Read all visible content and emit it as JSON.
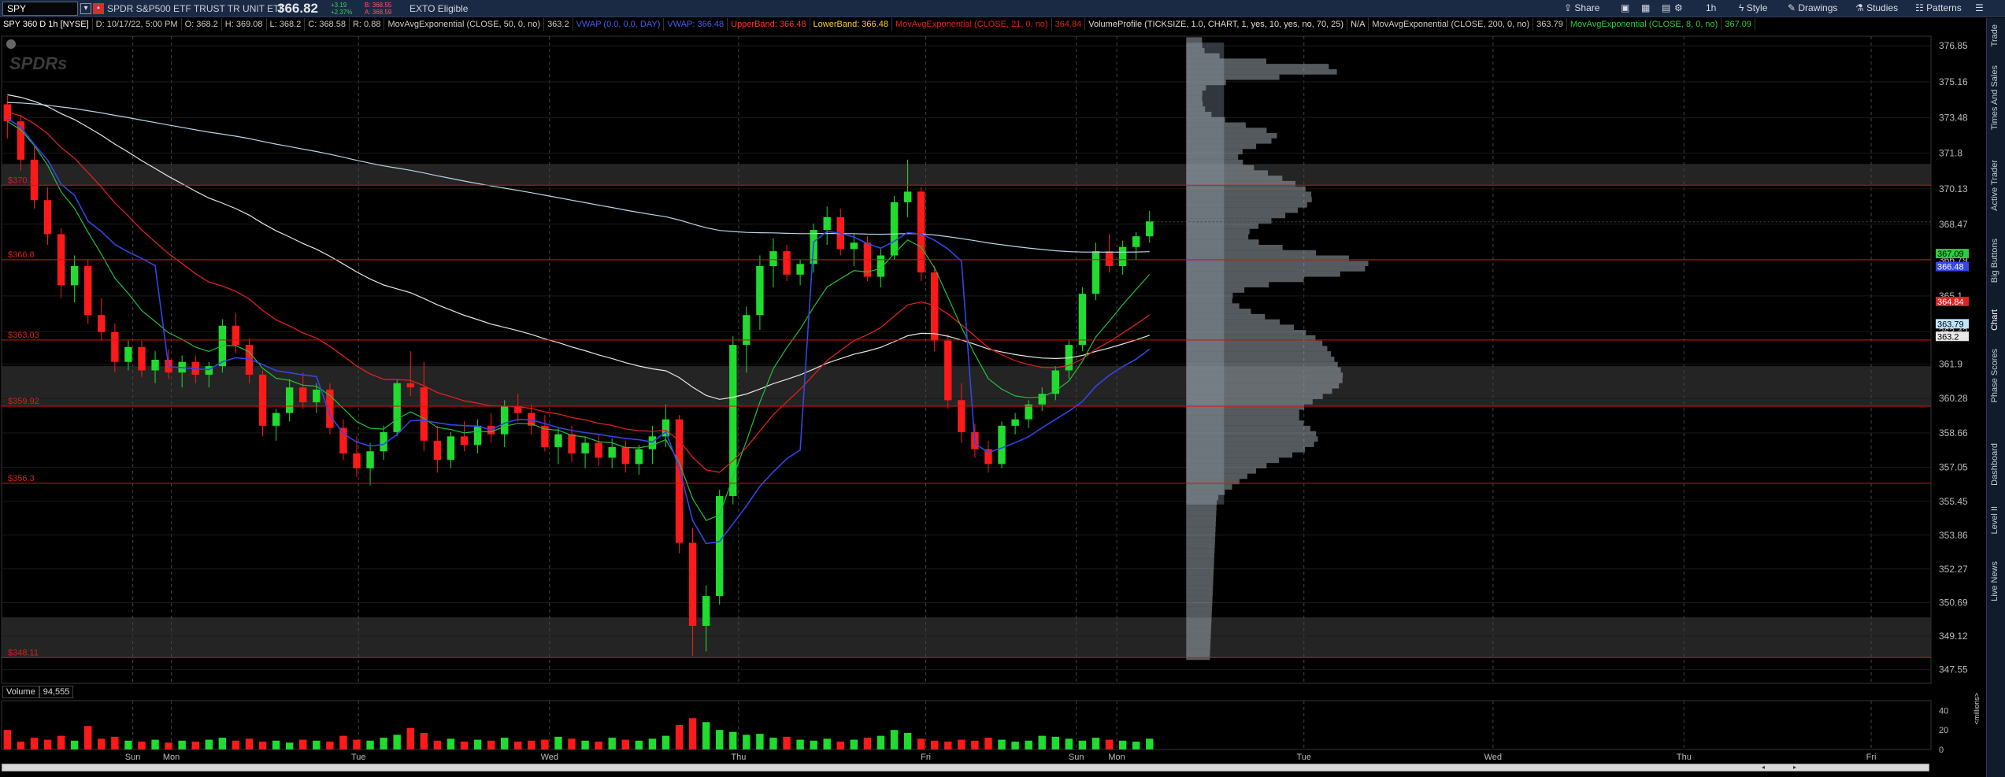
{
  "toolbar": {
    "symbol": "SPY",
    "instrument_name": "SPDR S&P500 ETF TRUST TR UNIT ETF",
    "last_price": "366.82",
    "change_abs": "+3.19",
    "change_pct": "+2.37%",
    "bid": "B: 368.55",
    "ask": "A: 368.59",
    "exto": "EXTO Eligible",
    "share": "Share",
    "timeframe": "1h",
    "style": "Style",
    "drawings": "Drawings",
    "studies": "Studies",
    "patterns": "Patterns"
  },
  "studies": [
    {
      "text": "SPY 360 D 1h [NYSE]",
      "color": "#ffffff"
    },
    {
      "text": "D: 10/17/22, 5:00 PM",
      "color": "#cccccc"
    },
    {
      "text": "O: 368.2",
      "color": "#cccccc"
    },
    {
      "text": "H: 369.08",
      "color": "#cccccc"
    },
    {
      "text": "L: 368.2",
      "color": "#cccccc"
    },
    {
      "text": "C: 368.58",
      "color": "#cccccc"
    },
    {
      "text": "R: 0.88",
      "color": "#cccccc"
    },
    {
      "text": "MovAvgExponential (CLOSE, 50, 0, no)",
      "color": "#cccccc"
    },
    {
      "text": "363.2",
      "color": "#cccccc"
    },
    {
      "text": "VWAP (0.0, 0.0, DAY)",
      "color": "#4a5cf0"
    },
    {
      "text": "VWAP: 366.48",
      "color": "#4a5cf0"
    },
    {
      "text": "UpperBand: 366.48",
      "color": "#ff3333"
    },
    {
      "text": "LowerBand: 366.48",
      "color": "#ffcc33"
    },
    {
      "text": "MovAvgExponential (CLOSE, 21, 0, no)",
      "color": "#e02020"
    },
    {
      "text": "364.84",
      "color": "#e02020"
    },
    {
      "text": "VolumeProfile (TICKSIZE, 1.0, CHART, 1, yes, 10, yes, no, 70, 25)",
      "color": "#dddddd"
    },
    {
      "text": "N/A",
      "color": "#dddddd"
    },
    {
      "text": "MovAvgExponential (CLOSE, 200, 0, no)",
      "color": "#cccccc"
    },
    {
      "text": "363.79",
      "color": "#cccccc"
    },
    {
      "text": "MovAvgExponential (CLOSE, 8, 0, no)",
      "color": "#2ecc40"
    },
    {
      "text": "367.09",
      "color": "#2ecc40"
    }
  ],
  "side_tabs": [
    "Trade",
    "Times And Sales",
    "Active Trader",
    "Big Buttons",
    "Chart",
    "Phase Scores",
    "Dashboard",
    "Level II",
    "Live News"
  ],
  "volume": {
    "label": "Volume",
    "value": "94,555"
  },
  "volume_axis_unit": "<millions>",
  "chart_data": {
    "type": "candlestick",
    "symbol": "SPY",
    "aggregation": "1h",
    "y_ticks": [
      376.85,
      375.16,
      373.48,
      371.8,
      370.13,
      368.47,
      366.79,
      365.1,
      363.42,
      361.9,
      360.28,
      358.66,
      357.05,
      355.45,
      353.86,
      352.27,
      350.69,
      349.12,
      347.55
    ],
    "y_range": [
      346.9,
      377.3
    ],
    "x_labels": [
      {
        "label": "Sun",
        "pos": 0.068
      },
      {
        "label": "Mon",
        "pos": 0.088
      },
      {
        "label": "Tue",
        "pos": 0.185
      },
      {
        "label": "Wed",
        "pos": 0.284
      },
      {
        "label": "Thu",
        "pos": 0.382
      },
      {
        "label": "Fri",
        "pos": 0.479
      },
      {
        "label": "Sun",
        "pos": 0.557
      },
      {
        "label": "Mon",
        "pos": 0.578
      },
      {
        "label": "Tue",
        "pos": 0.675
      },
      {
        "label": "Wed",
        "pos": 0.773
      },
      {
        "label": "Thu",
        "pos": 0.872
      },
      {
        "label": "Fri",
        "pos": 0.969
      }
    ],
    "price_lines": [
      {
        "label": "$370.3",
        "value": 370.3
      },
      {
        "label": "$366.8",
        "value": 366.8
      },
      {
        "label": "$363.03",
        "value": 363.03
      },
      {
        "label": "$359.92",
        "value": 359.92
      },
      {
        "label": "$356.3",
        "value": 356.3
      },
      {
        "label": "$348.11",
        "value": 348.11
      }
    ],
    "zones": [
      [
        370.3,
        371.3
      ],
      [
        359.92,
        361.8
      ],
      [
        348.11,
        350.0
      ]
    ],
    "price_tags": [
      {
        "value": 367.09,
        "text": "367.09",
        "bg": "#2ecc40",
        "fg": "#000000"
      },
      {
        "value": 366.48,
        "text": "366.48",
        "bg": "#3346e6",
        "fg": "#ffffff"
      },
      {
        "value": 364.84,
        "text": "364.84",
        "bg": "#e02020",
        "fg": "#ffffff"
      },
      {
        "value": 363.79,
        "text": "363.79",
        "bg": "#bfe6ff",
        "fg": "#000000"
      },
      {
        "value": 363.2,
        "text": "363.2",
        "bg": "#e8e8e8",
        "fg": "#000000"
      }
    ],
    "current_close": 368.58,
    "candles": [
      [
        374.1,
        374.5,
        372.5,
        373.3
      ],
      [
        373.3,
        373.6,
        371.0,
        371.5
      ],
      [
        371.5,
        372.1,
        369.2,
        369.6
      ],
      [
        369.6,
        370.2,
        367.5,
        368.0
      ],
      [
        368.0,
        368.3,
        365.0,
        365.6
      ],
      [
        365.6,
        367.0,
        364.8,
        366.5
      ],
      [
        366.5,
        366.8,
        363.8,
        364.2
      ],
      [
        364.2,
        365.0,
        363.0,
        363.4
      ],
      [
        363.4,
        363.8,
        361.5,
        362.0
      ],
      [
        362.0,
        363.0,
        361.6,
        362.7
      ],
      [
        362.7,
        363.0,
        361.3,
        361.6
      ],
      [
        361.6,
        362.5,
        361.0,
        362.1
      ],
      [
        362.1,
        362.6,
        361.2,
        361.5
      ],
      [
        361.5,
        362.3,
        360.8,
        362.0
      ],
      [
        362.0,
        362.3,
        361.0,
        361.4
      ],
      [
        361.4,
        362.0,
        360.8,
        361.8
      ],
      [
        361.8,
        364.0,
        361.5,
        363.7
      ],
      [
        363.7,
        364.3,
        362.4,
        362.8
      ],
      [
        362.8,
        363.1,
        361.0,
        361.4
      ],
      [
        361.4,
        361.6,
        358.5,
        359.0
      ],
      [
        359.0,
        359.8,
        358.3,
        359.6
      ],
      [
        359.6,
        361.2,
        359.2,
        360.8
      ],
      [
        360.8,
        361.5,
        359.8,
        360.1
      ],
      [
        360.1,
        361.0,
        359.6,
        360.7
      ],
      [
        360.7,
        361.0,
        358.6,
        358.9
      ],
      [
        358.9,
        359.3,
        357.4,
        357.7
      ],
      [
        357.7,
        358.5,
        356.6,
        357.0
      ],
      [
        357.0,
        358.2,
        356.2,
        357.8
      ],
      [
        357.8,
        359.0,
        357.4,
        358.7
      ],
      [
        358.7,
        361.2,
        358.5,
        361.0
      ],
      [
        361.0,
        362.5,
        360.4,
        360.8
      ],
      [
        360.8,
        362.0,
        357.8,
        358.3
      ],
      [
        358.3,
        359.0,
        356.8,
        357.4
      ],
      [
        357.4,
        358.7,
        357.0,
        358.5
      ],
      [
        358.5,
        359.2,
        357.8,
        358.1
      ],
      [
        358.1,
        359.3,
        357.7,
        359.0
      ],
      [
        359.0,
        359.6,
        358.2,
        358.6
      ],
      [
        358.6,
        360.2,
        358.0,
        359.9
      ],
      [
        359.9,
        360.5,
        359.2,
        359.6
      ],
      [
        359.6,
        360.0,
        358.6,
        359.0
      ],
      [
        359.0,
        359.5,
        357.8,
        358.0
      ],
      [
        358.0,
        358.9,
        357.2,
        358.6
      ],
      [
        358.6,
        359.0,
        357.3,
        357.7
      ],
      [
        357.7,
        358.5,
        357.0,
        358.2
      ],
      [
        358.2,
        358.6,
        357.1,
        357.5
      ],
      [
        357.5,
        358.4,
        357.0,
        358.0
      ],
      [
        358.0,
        358.3,
        356.8,
        357.2
      ],
      [
        357.2,
        358.1,
        356.7,
        357.9
      ],
      [
        357.9,
        359.0,
        357.2,
        358.5
      ],
      [
        358.5,
        360.0,
        358.0,
        359.3
      ],
      [
        359.3,
        359.5,
        353.0,
        353.5
      ],
      [
        353.5,
        354.2,
        348.2,
        349.6
      ],
      [
        349.6,
        351.5,
        348.4,
        351.0
      ],
      [
        351.0,
        356.0,
        350.6,
        355.7
      ],
      [
        355.7,
        363.2,
        355.3,
        362.8
      ],
      [
        362.8,
        364.6,
        361.5,
        364.2
      ],
      [
        364.2,
        367.0,
        363.5,
        366.5
      ],
      [
        366.5,
        367.8,
        365.5,
        367.2
      ],
      [
        367.2,
        367.5,
        365.8,
        366.1
      ],
      [
        366.1,
        366.8,
        365.6,
        366.6
      ],
      [
        366.6,
        368.5,
        366.2,
        368.2
      ],
      [
        368.2,
        369.3,
        367.5,
        368.8
      ],
      [
        368.8,
        369.2,
        367.0,
        367.3
      ],
      [
        367.3,
        368.0,
        366.5,
        367.6
      ],
      [
        367.6,
        367.9,
        365.8,
        366.0
      ],
      [
        366.0,
        367.3,
        365.5,
        367.0
      ],
      [
        367.0,
        369.8,
        366.8,
        369.5
      ],
      [
        369.5,
        371.5,
        368.8,
        370.0
      ],
      [
        370.0,
        370.2,
        365.8,
        366.2
      ],
      [
        366.2,
        366.5,
        362.5,
        363.0
      ],
      [
        363.0,
        363.3,
        359.8,
        360.2
      ],
      [
        360.2,
        361.0,
        358.2,
        358.7
      ],
      [
        358.7,
        359.1,
        357.5,
        357.9
      ],
      [
        357.9,
        358.3,
        356.8,
        357.2
      ],
      [
        357.2,
        359.2,
        357.0,
        359.0
      ],
      [
        359.0,
        359.6,
        358.6,
        359.3
      ],
      [
        359.3,
        360.2,
        358.9,
        360.0
      ],
      [
        360.0,
        360.8,
        359.7,
        360.5
      ],
      [
        360.5,
        361.8,
        360.2,
        361.6
      ],
      [
        361.6,
        363.0,
        361.2,
        362.8
      ],
      [
        362.8,
        365.5,
        362.5,
        365.2
      ],
      [
        365.2,
        367.6,
        364.9,
        367.2
      ],
      [
        367.2,
        368.0,
        366.2,
        366.5
      ],
      [
        366.5,
        367.7,
        366.1,
        367.4
      ],
      [
        367.4,
        368.1,
        366.8,
        367.9
      ],
      [
        367.9,
        369.1,
        367.6,
        368.6
      ]
    ],
    "volumes": [
      20,
      8,
      12,
      10,
      14,
      9,
      24,
      11,
      13,
      9,
      8,
      10,
      7,
      9,
      8,
      10,
      12,
      9,
      11,
      8,
      9,
      7,
      10,
      9,
      8,
      14,
      10,
      9,
      12,
      15,
      22,
      17,
      9,
      11,
      8,
      10,
      9,
      12,
      8,
      9,
      10,
      13,
      11,
      9,
      8,
      12,
      10,
      9,
      11,
      14,
      25,
      32,
      28,
      20,
      18,
      15,
      16,
      12,
      13,
      10,
      9,
      11,
      8,
      10,
      12,
      14,
      20,
      17,
      11,
      9,
      8,
      10,
      9,
      12,
      10,
      8,
      9,
      14,
      13,
      11,
      9,
      12,
      10,
      9,
      8,
      11
    ]
  }
}
